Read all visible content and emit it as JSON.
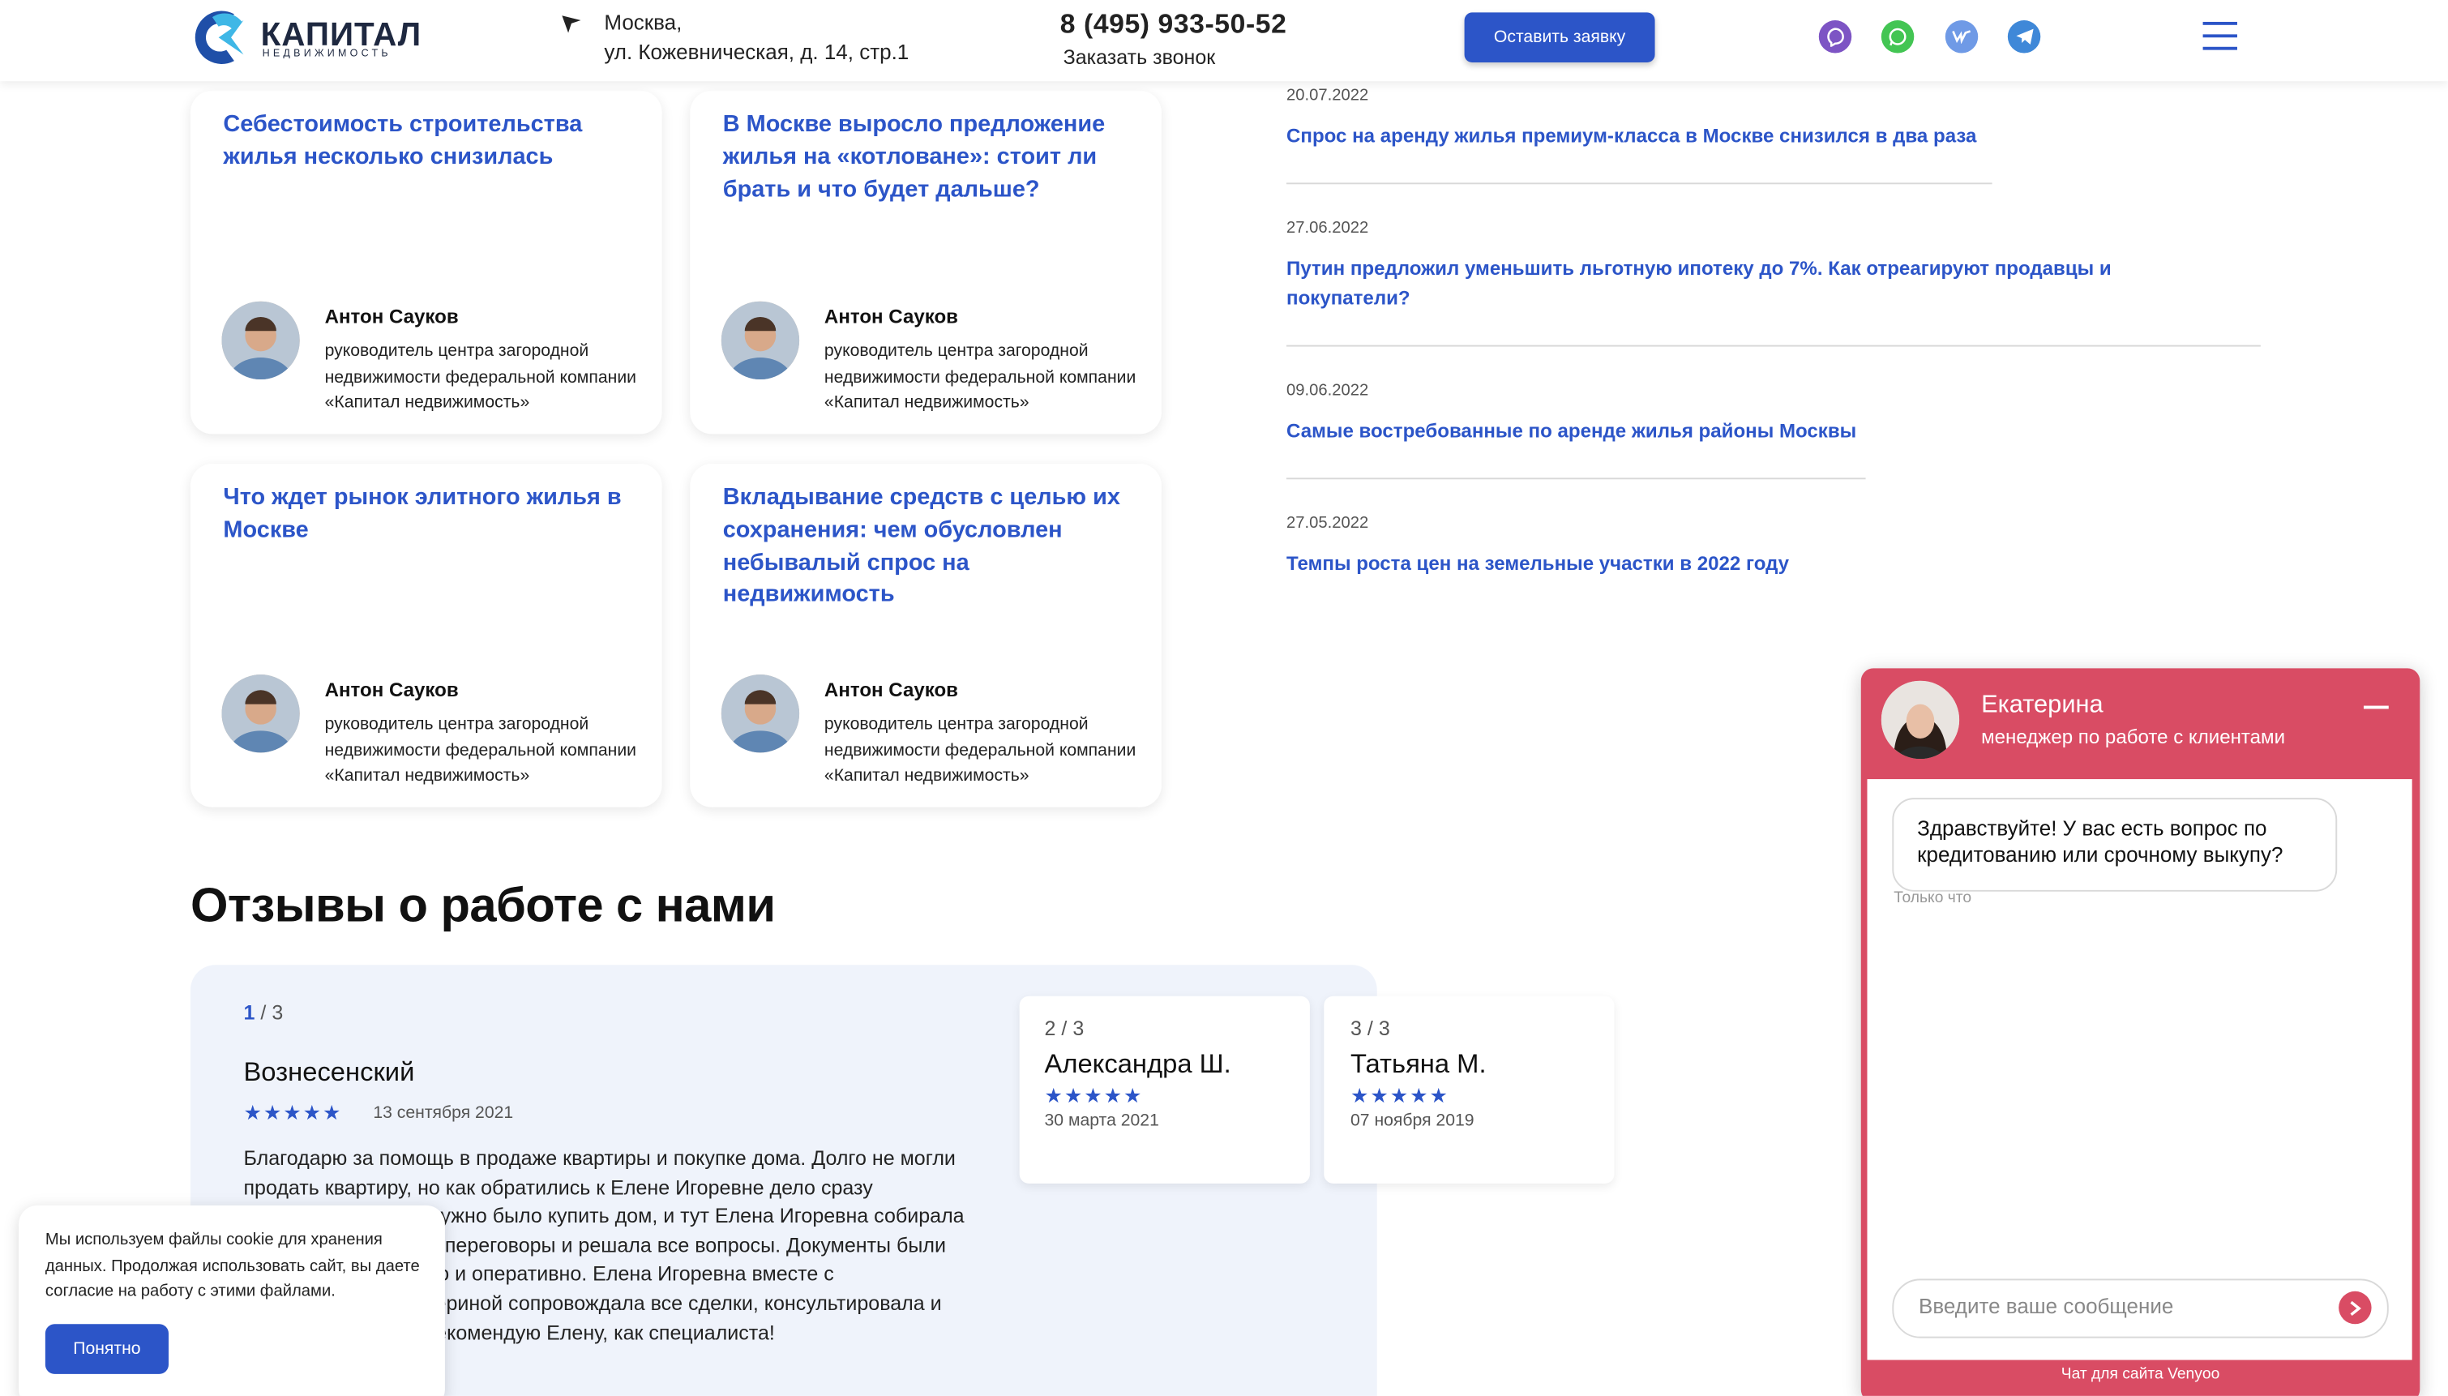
{
  "header": {
    "logo_word": "КАПИТАЛ",
    "logo_sub": "НЕДВИЖИМОСТЬ",
    "address_line1": "Москва,",
    "address_line2": "ул. Кожевническая, д. 14, стр.1",
    "phone": "8 (495) 933-50-52",
    "callback_label": "Заказать звонок",
    "apply_label": "Оставить заявку",
    "socials": [
      "viber-icon",
      "whatsapp-icon",
      "vk-icon",
      "telegram-icon"
    ],
    "brand_color": "#2c55c8"
  },
  "articles": [
    {
      "title": "Себестоимость строительства жилья несколько снизилась",
      "author": "Антон Сауков",
      "role": "руководитель центра загородной недвижимости федеральной компании «Капитал недвижимость»"
    },
    {
      "title": "В Москве выросло предложение жилья на «котловане»: стоит ли брать и что будет дальше?",
      "author": "Антон Сауков",
      "role": "руководитель центра загородной недвижимости федеральной компании «Капитал недвижимость»"
    },
    {
      "title": "Что ждет рынок элитного жилья в Москве",
      "author": "Антон Сауков",
      "role": "руководитель центра загородной недвижимости федеральной компании «Капитал недвижимость»"
    },
    {
      "title": "Вкладывание средств с целью их сохранения: чем обусловлен небывалый спрос на недвижимость",
      "author": "Антон Сауков",
      "role": "руководитель центра загородной недвижимости федеральной компании «Капитал недвижимость»"
    }
  ],
  "news": [
    {
      "date": "20.07.2022",
      "title": "Спрос на аренду жилья премиум-класса в Москве снизился в два раза"
    },
    {
      "date": "27.06.2022",
      "title": "Путин предложил уменьшить льготную ипотеку до 7%. Как отреагируют продавцы и покупатели?"
    },
    {
      "date": "09.06.2022",
      "title": "Самые востребованные по аренде жилья районы Москвы"
    },
    {
      "date": "27.05.2022",
      "title": "Темпы роста цен на земельные участки в 2022 году"
    }
  ],
  "reviews": {
    "heading": "Отзывы о работе с нами",
    "slash": "/",
    "items": [
      {
        "index": "1",
        "total": "3",
        "name": "Вознесенский",
        "stars": "★★★★★",
        "rating": 5,
        "date": "13 сентября 2021",
        "text": "Благодарю за помощь в продаже квартиры и покупке дома. Долго не могли продать квартиру, но как обратились к Елене Игоревне дело сразу сдвинулось. Потом нужно было купить дом, и тут Елена Игоревна собирала все документы, вела переговоры и решала все вопросы. Документы были оформлены грамотно и оперативно. Елена Игоревна вместе с руководителем Екатериной сопровождала все сделки, консультировала и помогала во всем. Рекомендую Елену, как специалиста!"
      },
      {
        "index": "2",
        "total": "3",
        "name": "Александра Ш.",
        "stars": "★★★★★",
        "rating": 5,
        "date": "30 марта 2021"
      },
      {
        "index": "3",
        "total": "3",
        "name": "Татьяна М.",
        "stars": "★★★★★",
        "rating": 5,
        "date": "07 ноября 2019"
      }
    ]
  },
  "cookie": {
    "text": "Мы используем файлы cookie для хранения данных. Продолжая использовать сайт, вы даете согласие на работу с этими файлами.",
    "button": "Понятно"
  },
  "chat": {
    "agent_name": "Екатерина",
    "agent_role": "менеджер по работе с клиентами",
    "message": "Здравствуйте! У вас есть вопрос по кредитованию или срочному выкупу?",
    "message_time": "Только что",
    "input_placeholder": "Введите ваше сообщение",
    "footer": "Чат для сайта Venyoo",
    "accent_color": "#d94c64"
  }
}
